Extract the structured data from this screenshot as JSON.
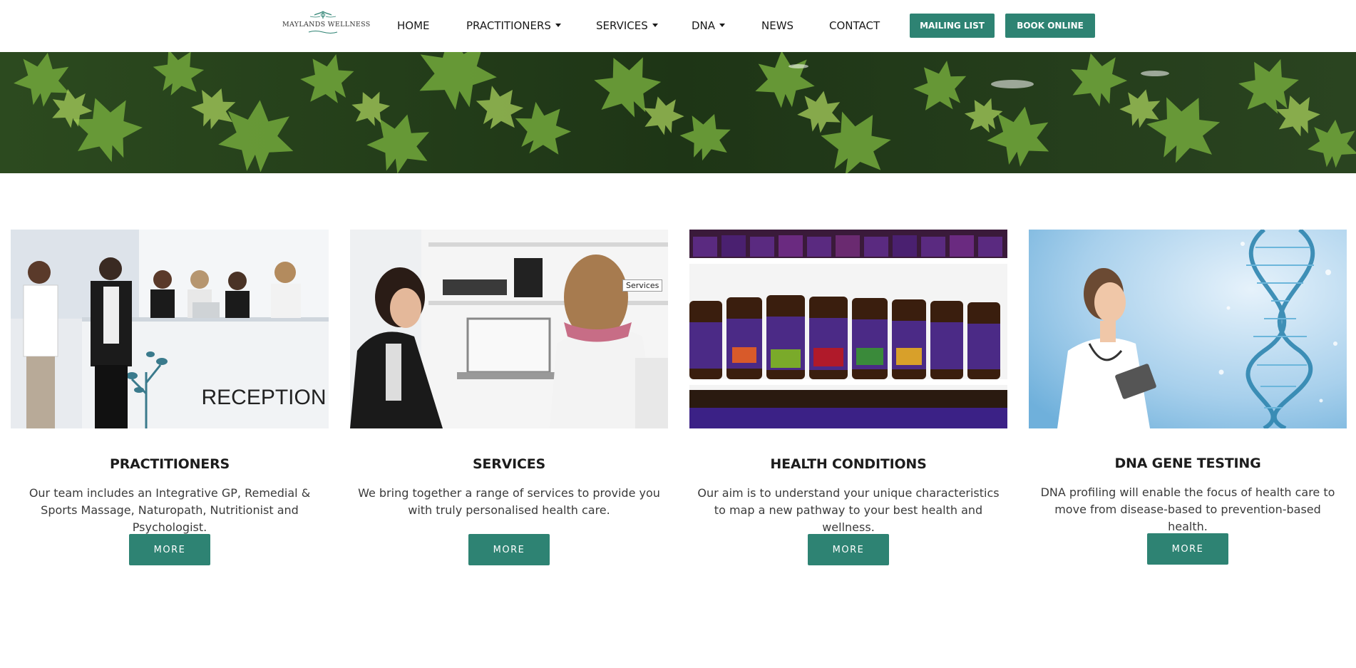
{
  "header": {
    "logo_text": "MAYLANDS WELLNESS",
    "nav": [
      {
        "label": "HOME",
        "has_dropdown": false
      },
      {
        "label": "PRACTITIONERS",
        "has_dropdown": true
      },
      {
        "label": "SERVICES",
        "has_dropdown": true
      },
      {
        "label": "DNA",
        "has_dropdown": true
      },
      {
        "label": "NEWS",
        "has_dropdown": false
      },
      {
        "label": "CONTACT",
        "has_dropdown": false
      }
    ],
    "mailing_list_label": "MAILING LIST",
    "book_online_label": "BOOK ONLINE"
  },
  "colors": {
    "accent": "#2e8373",
    "text_dark": "#1c1c1c",
    "text_body": "#3a3a3a"
  },
  "cards": [
    {
      "title": "PRACTITIONERS",
      "text": "Our team includes an Integrative GP, Remedial & Sports Massage, Naturopath, Nutritionist and Psychologist.",
      "button": "MORE",
      "image_sign": "RECEPTION"
    },
    {
      "title": "SERVICES",
      "text": "We bring together a range of services to provide you with truly personalised health care.",
      "button": "MORE",
      "tooltip": "Services"
    },
    {
      "title": "HEALTH CONDITIONS",
      "text": "Our aim is to understand your unique characteristics to map a new pathway to your best health and wellness.",
      "button": "MORE"
    },
    {
      "title": "DNA GENE TESTING",
      "text": "DNA profiling will enable the focus of health care to move from disease-based to prevention-based health.",
      "button": "MORE"
    }
  ]
}
